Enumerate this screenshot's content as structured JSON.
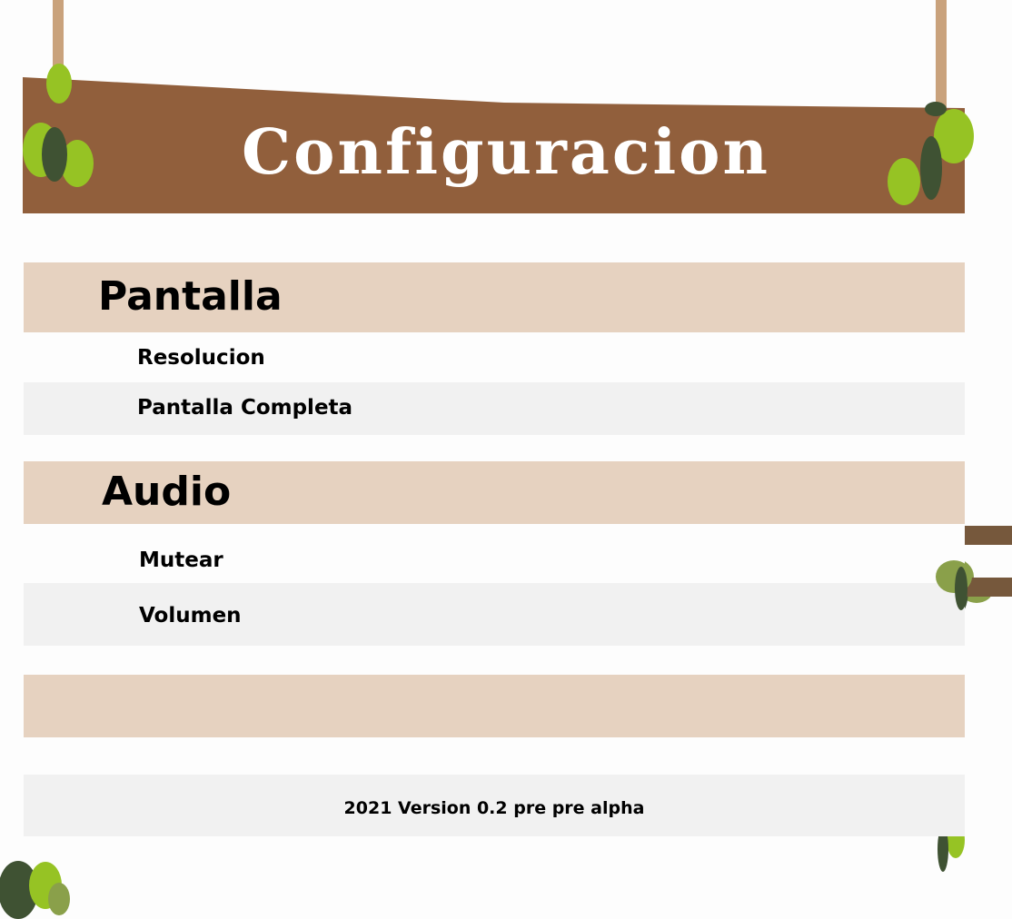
{
  "header": {
    "title": "Configuracion",
    "colors": {
      "board": "#915f3c",
      "leaf_light": "#96c324",
      "leaf_dark": "#3f5233"
    }
  },
  "sections": [
    {
      "title": "Pantalla",
      "items": [
        "Resolucion",
        "Pantalla Completa"
      ]
    },
    {
      "title": "Audio",
      "items": [
        "Mutear",
        "Volumen"
      ]
    }
  ],
  "footer": {
    "text": "2021 Version 0.2 pre pre alpha"
  },
  "colors": {
    "section_header": "#e6d2c0",
    "row_alt": "#f1f1f1",
    "side_tab": "#76583c"
  }
}
